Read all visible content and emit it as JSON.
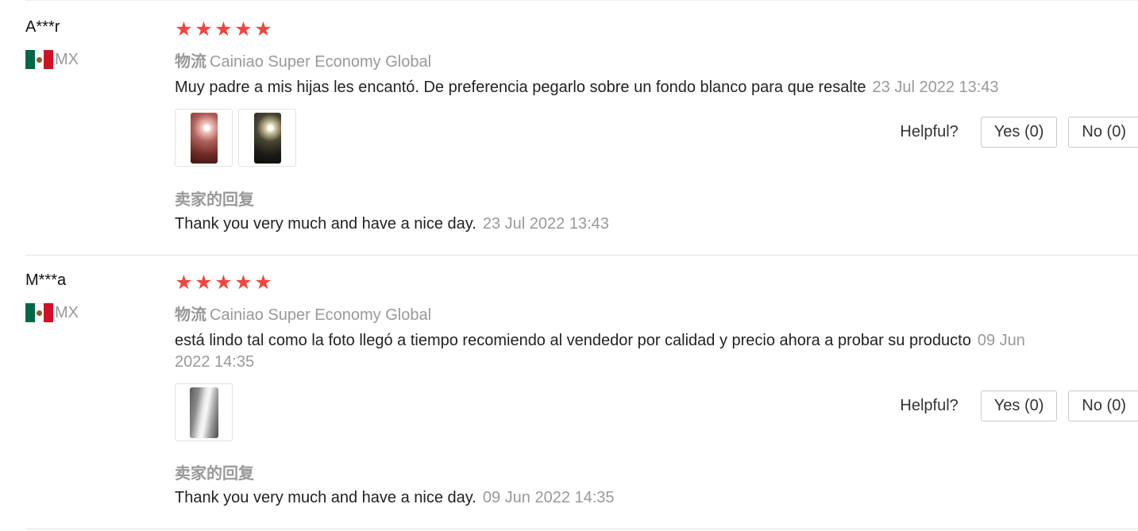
{
  "helpful_label": "Helpful?",
  "logistics_label": "物流",
  "seller_reply_label": "卖家的回复",
  "rating_star_glyph": "★",
  "reviews": [
    {
      "user": "A***r",
      "country": "MX",
      "rating": 5,
      "logistics": "Cainiao Super Economy Global",
      "text": "Muy padre a mis hijas les encantó. De preferencia pegarlo sobre un fondo blanco para que resalte",
      "date": "23 Jul 2022 13:43",
      "photos": [
        "pink-rose-lamp-photo",
        "dark-rose-lamp-photo"
      ],
      "yes": "Yes (0)",
      "no": "No (0)",
      "seller_reply": "Thank you very much and have a nice day.",
      "seller_reply_date": "23 Jul 2022 13:43"
    },
    {
      "user": "M***a",
      "country": "MX",
      "rating": 5,
      "logistics": "Cainiao Super Economy Global",
      "text": "está lindo tal como la foto llegó a tiempo recomiendo al vendedor por calidad y precio ahora a probar su producto",
      "date": "09 Jun 2022 14:35",
      "photos": [
        "silver-tube-photo"
      ],
      "yes": "Yes (0)",
      "no": "No (0)",
      "seller_reply": "Thank you very much and have a nice day.",
      "seller_reply_date": "09 Jun 2022 14:35"
    }
  ],
  "colors": {
    "star": "#f0453f",
    "muted_text": "#999999",
    "body_text": "#222222",
    "divider": "#e4e4e4",
    "flag_green": "#006847",
    "flag_red": "#ce1126"
  }
}
